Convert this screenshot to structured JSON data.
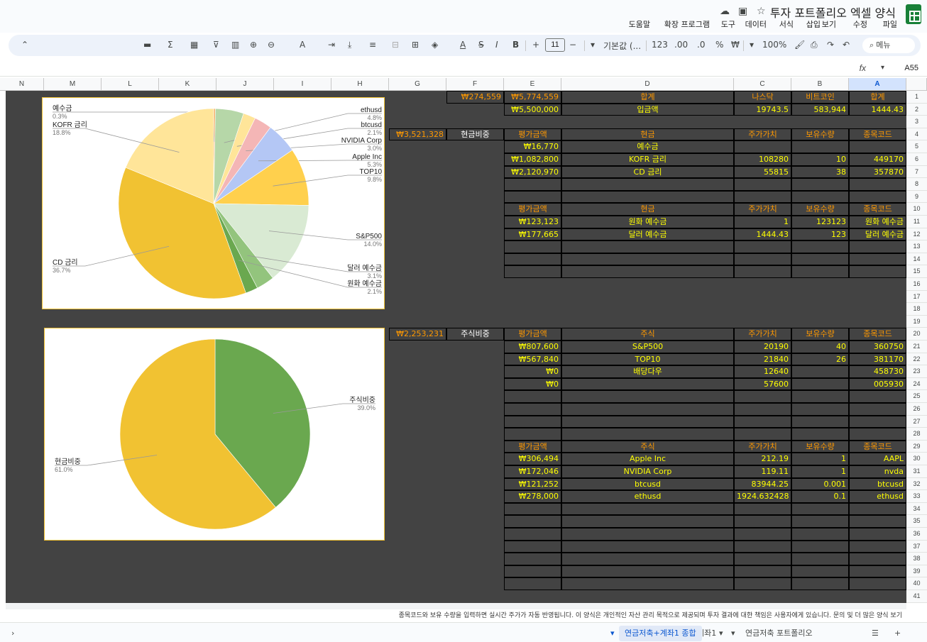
{
  "app": {
    "title": "투자 포트폴리오 엑셀 양식",
    "menu": [
      "파일",
      "수정",
      "보기",
      "삽입",
      "서식",
      "데이터",
      "도구",
      "확장 프로그램",
      "도움말"
    ]
  },
  "toolbar": {
    "search_label": "메뉴",
    "zoom": "100%",
    "currency": "₩",
    "percent": "%",
    "decimal_dec": ".0",
    "decimal_inc": ".00",
    "number_format": "123",
    "font": "기본값 (...",
    "font_size": "11",
    "bold": "B",
    "italic": "I",
    "strike": "S",
    "text_color": "A",
    "sigma": "Σ"
  },
  "formula_bar": {
    "cell_ref": "A55",
    "fx": "fx"
  },
  "columns": [
    "A",
    "B",
    "C",
    "D",
    "E",
    "F",
    "G",
    "H",
    "I",
    "J",
    "K",
    "L",
    "M",
    "N"
  ],
  "rows": [
    "1",
    "2",
    "3",
    "4",
    "5",
    "6",
    "7",
    "8",
    "9",
    "10",
    "11",
    "12",
    "13",
    "14",
    "15",
    "16",
    "17",
    "18",
    "19",
    "20",
    "21",
    "22",
    "23",
    "24",
    "25",
    "26",
    "27",
    "28",
    "29",
    "30",
    "31",
    "32",
    "33",
    "34",
    "35",
    "36",
    "37",
    "38",
    "39",
    "40",
    "41"
  ],
  "summary": {
    "h_total": "합계",
    "h_bitcoin": "비트코인",
    "h_nasdaq": "나스닥",
    "h_total_label": "합계",
    "total_value": "₩5,774,559",
    "total_f": "₩274,559",
    "r2_a": "1444.43",
    "r2_b": "583,944",
    "r2_c": "19743.5",
    "r2_d": "입금액",
    "r2_e": "₩5,500,000"
  },
  "t1": {
    "headers": [
      "종목코드",
      "보유수량",
      "주가가치",
      "현금",
      "평가금액",
      "현금비중",
      "₩3,521,328"
    ],
    "rows": [
      [
        "",
        "",
        "",
        "예수금",
        "₩16,770"
      ],
      [
        "449170",
        "10",
        "108280",
        "KOFR 금리",
        "₩1,082,800"
      ],
      [
        "357870",
        "38",
        "55815",
        "CD 금리",
        "₩2,120,970"
      ]
    ]
  },
  "t2": {
    "headers": [
      "종목코드",
      "보유수량",
      "주가가치",
      "현금",
      "평가금액"
    ],
    "rows": [
      [
        "원화 예수금",
        "123123",
        "1",
        "원화 예수금",
        "₩123,123"
      ],
      [
        "달러 예수금",
        "123",
        "1444.43",
        "달러 예수금",
        "₩177,665"
      ]
    ]
  },
  "t3": {
    "headers": [
      "종목코드",
      "보유수량",
      "주가가치",
      "주식",
      "평가금액",
      "주식비중",
      "₩2,253,231"
    ],
    "rows": [
      [
        "360750",
        "40",
        "20190",
        "S&P500",
        "₩807,600"
      ],
      [
        "381170",
        "26",
        "21840",
        "TOP10",
        "₩567,840"
      ],
      [
        "458730",
        "",
        "12640",
        "배당다우",
        "₩0"
      ],
      [
        "005930",
        "",
        "57600",
        "",
        "₩0"
      ]
    ]
  },
  "t4": {
    "headers": [
      "종목코드",
      "보유수량",
      "주가가치",
      "주식",
      "평가금액"
    ],
    "rows": [
      [
        "AAPL",
        "1",
        "212.19",
        "Apple Inc",
        "₩306,494"
      ],
      [
        "nvda",
        "1",
        "119.11",
        "NVIDIA Corp",
        "₩172,046"
      ],
      [
        "btcusd",
        "0.001",
        "83944.25",
        "btcusd",
        "₩121,252"
      ],
      [
        "ethusd",
        "0.1",
        "1924.632428",
        "ethusd",
        "₩278,000"
      ]
    ]
  },
  "chart_data": [
    {
      "type": "pie",
      "slices": [
        {
          "label": "예수금",
          "value": 0.3,
          "pct": "0.3%",
          "color": "#f6b26b"
        },
        {
          "label": "ethusd",
          "value": 4.8,
          "pct": "4.8%",
          "color": "#b6d7a8"
        },
        {
          "label": "btcusd",
          "value": 2.1,
          "pct": "2.1%",
          "color": "#ffe599"
        },
        {
          "label": "NVIDIA Corp",
          "value": 3.0,
          "pct": "3.0%",
          "color": "#f4b6b6"
        },
        {
          "label": "Apple Inc",
          "value": 5.3,
          "pct": "5.3%",
          "color": "#b4c7f5"
        },
        {
          "label": "TOP10",
          "value": 9.8,
          "pct": "9.8%",
          "color": "#ffd04d"
        },
        {
          "label": "S&P500",
          "value": 14.0,
          "pct": "14.0%",
          "color": "#d9ead3"
        },
        {
          "label": "달러 예수금",
          "value": 3.1,
          "pct": "3.1%",
          "color": "#93c47d"
        },
        {
          "label": "원화 예수금",
          "value": 2.1,
          "pct": "2.1%",
          "color": "#6aa84f"
        },
        {
          "label": "CD 금리",
          "value": 36.7,
          "pct": "36.7%",
          "color": "#f1c232"
        },
        {
          "label": "KOFR 금리",
          "value": 18.8,
          "pct": "18.8%",
          "color": "#ffe599"
        }
      ]
    },
    {
      "type": "pie",
      "slices": [
        {
          "label": "주식비중",
          "value": 39.0,
          "pct": "39.0%",
          "color": "#6aa84f"
        },
        {
          "label": "현금비중",
          "value": 61.0,
          "pct": "61.0%",
          "color": "#f1c232"
        }
      ]
    }
  ],
  "note": "종목코드와 보유 수량을 입력하면 실시간 주가가 자동 반영됩니다. 이 양식은 개인적인 자산 관리 목적으로 제공되며 투자 결과에 대한 책임은 사용자에게 있습니다. 문의 및 더 많은 양식 보기",
  "sheets": [
    "연금저축+계좌1 종합",
    "계좌1",
    "연금저축 포트폴리오"
  ]
}
